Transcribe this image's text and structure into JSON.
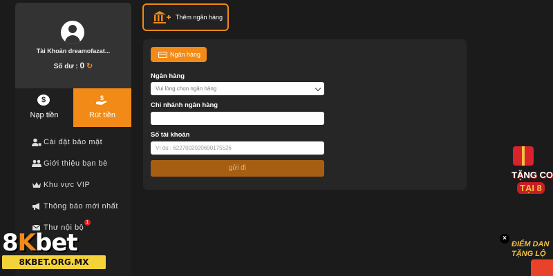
{
  "sidebar": {
    "account_name": "Tài Khoản dreamofazat...",
    "balance_label": "Số dư :",
    "balance_value": "0",
    "tabs": [
      {
        "label": "Nạp tiền",
        "active": false
      },
      {
        "label": "Rút tiền",
        "active": true
      }
    ],
    "menu": [
      {
        "label": "Cài đặt bảo mật",
        "icon": "user-lock-icon"
      },
      {
        "label": "Giới thiệu bạn bè",
        "icon": "friends-icon"
      },
      {
        "label": "Khu vực VIP",
        "icon": "crown-icon"
      },
      {
        "label": "Thông báo mới nhất",
        "icon": "megaphone-icon"
      },
      {
        "label": "Thư nội bộ",
        "icon": "mail-icon",
        "badge": "1"
      }
    ]
  },
  "header": {
    "add_bank_label": "Thêm ngân hàng"
  },
  "form": {
    "section_pill": "Ngân hàng",
    "bank_label": "Ngân hàng",
    "bank_select_value": "Vui lòng chọn ngân hàng",
    "branch_label": "Chi nhánh ngân hàng",
    "branch_value": "",
    "account_label": "Số tài khoản",
    "account_placeholder": "Ví dụ : 6227002020690175526",
    "submit_label": "gửi đi"
  },
  "logo": {
    "brand_prefix": "8",
    "brand_k": "K",
    "brand_suffix": "bet",
    "url": "8KBET.ORG.MX"
  },
  "promos": {
    "promo1_line1": "TẶNG CO",
    "promo1_line2": "TẠI 8",
    "promo2_line1": "ĐIỂM DAN",
    "promo2_line2": "TẶNG LỘ",
    "close_label": "×"
  },
  "colors": {
    "accent": "#f18a17",
    "background": "#1b1b1b",
    "panel": "#262626",
    "submit_disabled": "#a65f12"
  }
}
